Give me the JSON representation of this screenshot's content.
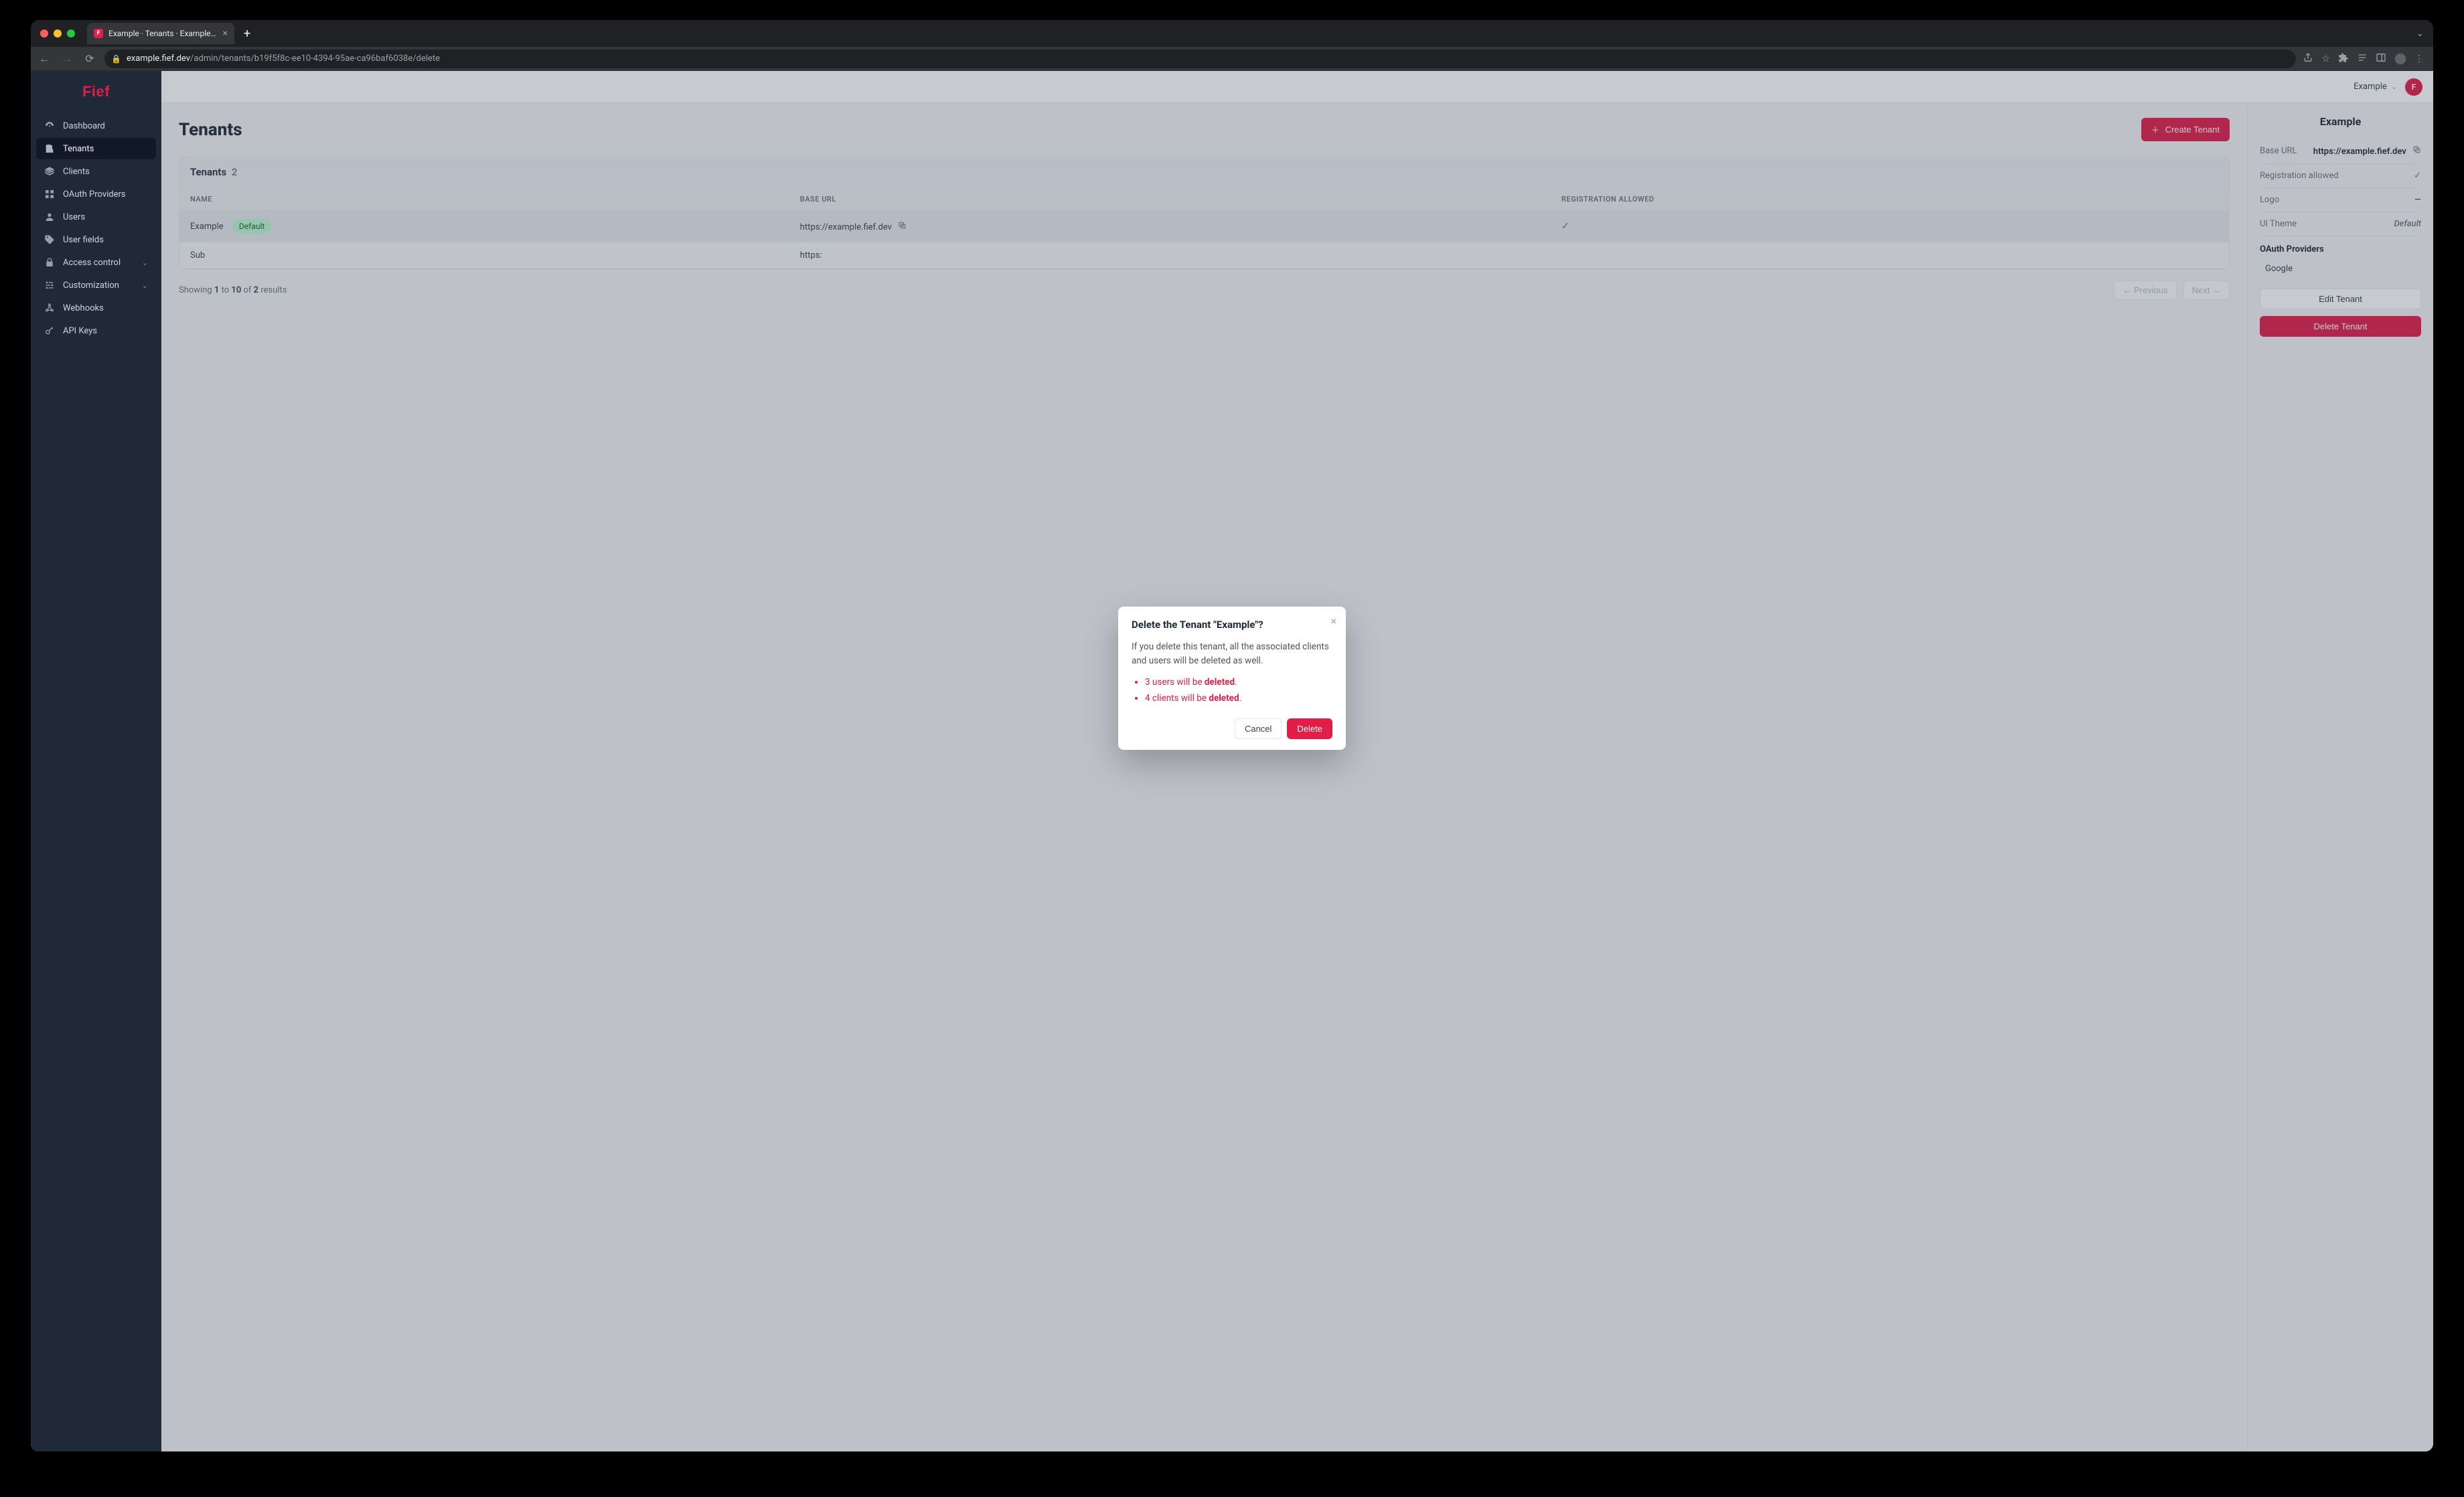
{
  "browser": {
    "tab_title": "Example · Tenants · Example · F",
    "url_host": "example.fief.dev",
    "url_path": "/admin/tenants/b19f5f8c-ee10-4394-95ae-ca96baf6038e/delete"
  },
  "brand": {
    "name": "Fief"
  },
  "sidebar": {
    "items": [
      {
        "label": "Dashboard"
      },
      {
        "label": "Tenants"
      },
      {
        "label": "Clients"
      },
      {
        "label": "OAuth Providers"
      },
      {
        "label": "Users"
      },
      {
        "label": "User fields"
      },
      {
        "label": "Access control",
        "expandable": true
      },
      {
        "label": "Customization",
        "expandable": true
      },
      {
        "label": "Webhooks"
      },
      {
        "label": "API Keys"
      }
    ]
  },
  "topbar": {
    "tenant_name": "Example",
    "avatar_initial": "F"
  },
  "page": {
    "title": "Tenants",
    "create_label": "Create Tenant",
    "card_title": "Tenants",
    "count": "2",
    "columns": {
      "name": "NAME",
      "base_url": "BASE URL",
      "registration": "REGISTRATION ALLOWED"
    },
    "rows": [
      {
        "name": "Example",
        "is_default": true,
        "default_badge": "Default",
        "base_url": "https://example.fief.dev",
        "registration_allowed": true
      },
      {
        "name": "Sub",
        "is_default": false,
        "base_url": "https:",
        "registration_allowed": false
      }
    ],
    "pagination": {
      "from": "1",
      "to": "10",
      "total": "2",
      "prev_label": "Previous",
      "next_label": "Next"
    }
  },
  "detail": {
    "title": "Example",
    "props": {
      "base_url_label": "Base URL",
      "base_url_value": "https://example.fief.dev",
      "registration_label": "Registration allowed",
      "logo_label": "Logo",
      "logo_value": "—",
      "theme_label": "UI Theme",
      "theme_value": "Default"
    },
    "oauth_heading": "OAuth Providers",
    "oauth_items": [
      "Google"
    ],
    "actions": {
      "edit": "Edit Tenant",
      "delete": "Delete Tenant"
    }
  },
  "modal": {
    "title": "Delete the Tenant \"Example\"?",
    "body": "If you delete this tenant, all the associated clients and users will be deleted as well.",
    "bullets": [
      {
        "prefix": "3 users will be ",
        "strong": "deleted",
        "suffix": "."
      },
      {
        "prefix": "4 clients will be ",
        "strong": "deleted",
        "suffix": "."
      }
    ],
    "cancel_label": "Cancel",
    "delete_label": "Delete"
  },
  "pagination_strings": {
    "showing": "Showing",
    "to": "to",
    "of": "of",
    "results": "results"
  }
}
